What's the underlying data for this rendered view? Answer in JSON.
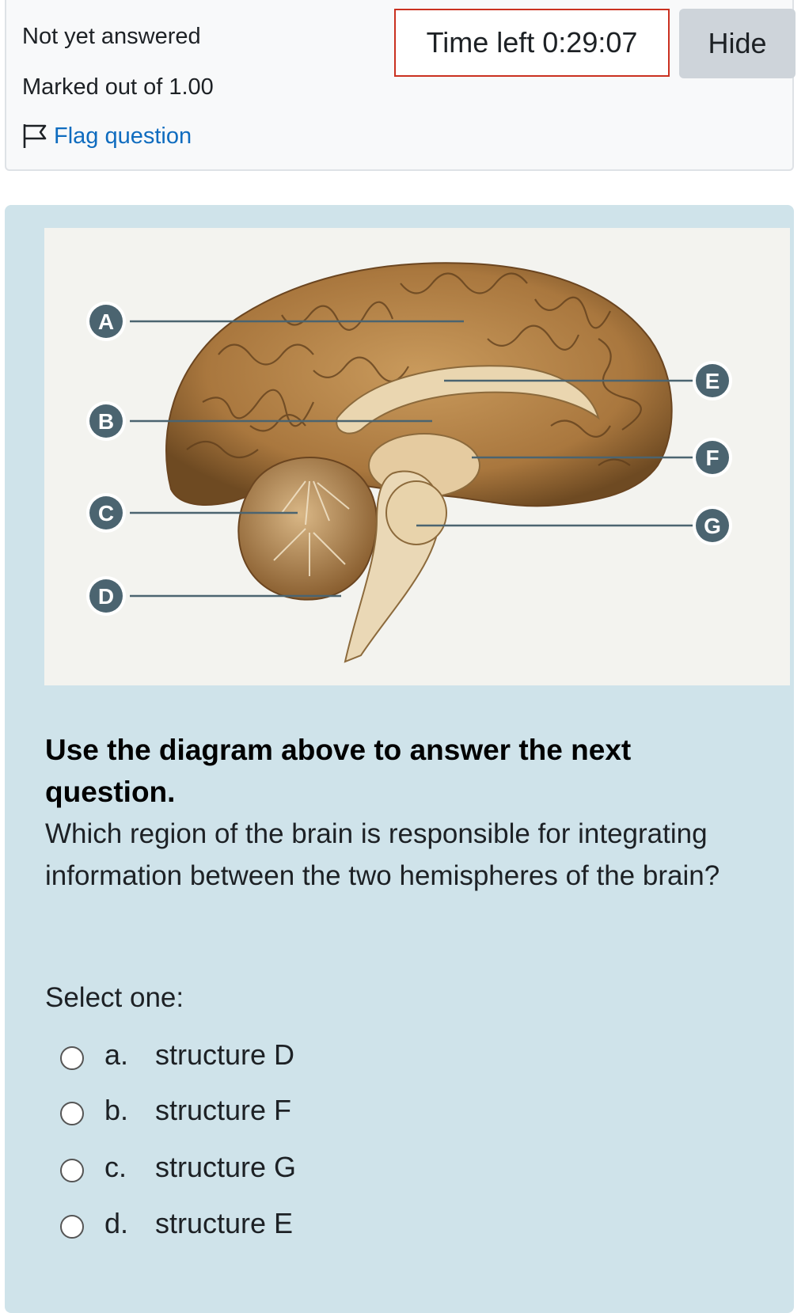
{
  "info": {
    "status": "Not yet answered",
    "marked": "Marked out of 1.00",
    "flag_label": "Flag question"
  },
  "timer": {
    "text": "Time left 0:29:07"
  },
  "hide_label": "Hide",
  "diagram": {
    "labels": [
      "A",
      "B",
      "C",
      "D",
      "E",
      "F",
      "G"
    ]
  },
  "question": {
    "title": "Use the diagram above to answer the next question.",
    "text": "Which region of the brain is responsible for integrating information between the two hemispheres of the brain?",
    "select_label": "Select one:",
    "options": [
      {
        "letter": "a.",
        "text": "structure D"
      },
      {
        "letter": "b.",
        "text": "structure F"
      },
      {
        "letter": "c.",
        "text": "structure G"
      },
      {
        "letter": "d.",
        "text": "structure E"
      }
    ]
  },
  "colors": {
    "link": "#0f6cbf",
    "timer_border": "#ca3120",
    "question_bg": "#cfe3ea",
    "label_circle": "#4b6470"
  }
}
